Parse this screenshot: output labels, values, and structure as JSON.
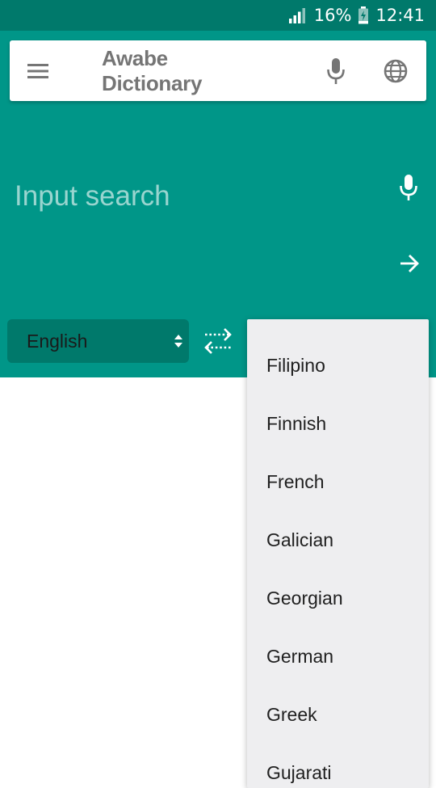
{
  "status_bar": {
    "battery_percent": "16%",
    "time": "12:41",
    "icons": [
      "signal-icon",
      "battery-charging-icon"
    ]
  },
  "toolbar": {
    "title": "Awabe Dictionary",
    "icons": [
      "menu-icon",
      "mic-icon",
      "globe-icon"
    ]
  },
  "search": {
    "placeholder": "Input search",
    "value": "",
    "icons": [
      "mic-icon",
      "arrow-right-icon"
    ]
  },
  "language": {
    "source": "English",
    "swap_icon": "swap-arrows-icon"
  },
  "dropdown": {
    "options": [
      "Filipino",
      "Finnish",
      "French",
      "Galician",
      "Georgian",
      "German",
      "Greek",
      "Gujarati"
    ]
  },
  "colors": {
    "primary": "#009688",
    "primary_dark": "#00796b",
    "toolbar_text": "#757575",
    "dropdown_bg": "#eeeef0"
  }
}
